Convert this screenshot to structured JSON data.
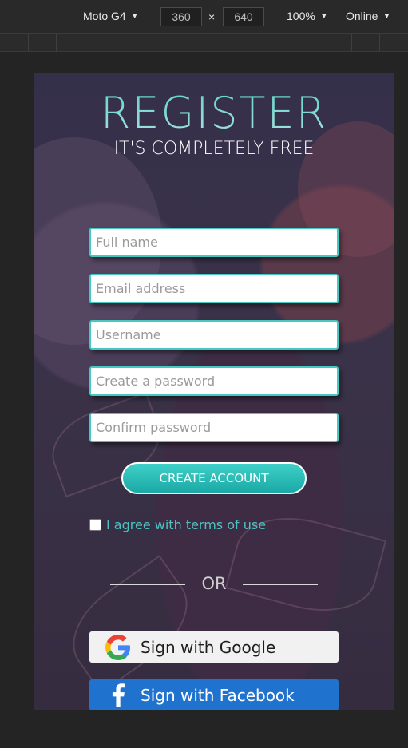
{
  "devtools": {
    "device": "Moto G4",
    "width": "360",
    "height": "640",
    "times": "×",
    "zoom": "100%",
    "network": "Online"
  },
  "page": {
    "title": "REGISTER",
    "subtitle": "IT'S COMPLETELY FREE",
    "fields": {
      "full_name": "Full name",
      "email": "Email address",
      "username": "Username",
      "password": "Create a password",
      "confirm": "Confirm password"
    },
    "create_button": "CREATE ACCOUNT",
    "agree_label": "I agree with terms of use",
    "agree_checked": false,
    "or_label": "OR",
    "google_label": "Sign with Google",
    "facebook_label": "Sign with Facebook"
  },
  "colors": {
    "accent": "#45c7c2",
    "facebook": "#1f73cf"
  },
  "icons": [
    "caret-down-icon",
    "google-icon",
    "facebook-icon"
  ]
}
